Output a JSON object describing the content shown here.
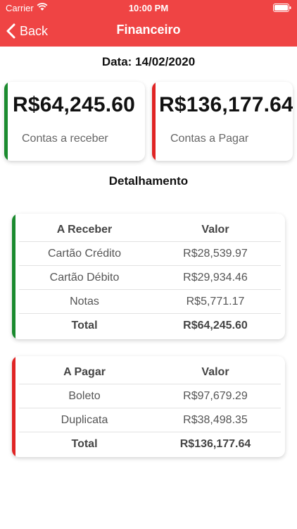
{
  "status": {
    "carrier": "Carrier",
    "time": "10:00 PM"
  },
  "nav": {
    "back_label": "Back",
    "title": "Financeiro"
  },
  "date_line": "Data: 14/02/2020",
  "summary": {
    "receivable": {
      "amount": "R$64,245.60",
      "label": "Contas a receber",
      "color": "#1a8a2e"
    },
    "payable": {
      "amount": "R$136,177.64",
      "label": "Contas a Pagar",
      "color": "#e02424"
    }
  },
  "section_title": "Detalhamento",
  "receber_table": {
    "headers": [
      "A Receber",
      "Valor"
    ],
    "rows": [
      {
        "label": "Cartão Crédito",
        "value": "R$28,539.97"
      },
      {
        "label": "Cartão Débito",
        "value": "R$29,934.46"
      },
      {
        "label": "Notas",
        "value": "R$5,771.17"
      }
    ],
    "total": {
      "label": "Total",
      "value": "R$64,245.60"
    },
    "color": "#1a8a2e"
  },
  "pagar_table": {
    "headers": [
      "A Pagar",
      "Valor"
    ],
    "rows": [
      {
        "label": "Boleto",
        "value": "R$97,679.29"
      },
      {
        "label": "Duplicata",
        "value": "R$38,498.35"
      }
    ],
    "total": {
      "label": "Total",
      "value": "R$136,177.64"
    },
    "color": "#e02424"
  },
  "colors": {
    "header": "#ef4444",
    "green": "#1a8a2e",
    "red": "#e02424"
  }
}
